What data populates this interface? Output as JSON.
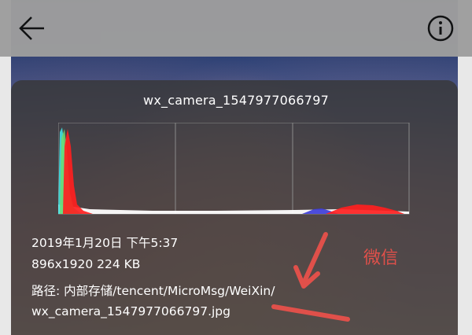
{
  "header": {
    "back_icon": "arrow-left-icon",
    "info_icon": "info-circle-icon"
  },
  "details": {
    "filename": "wx_camera_1547977066797",
    "date_time": "2019年1月20日 下午5:37",
    "dimensions_size": "896x1920  224 KB",
    "path_line1": "路径: 内部存储/tencent/MicroMsg/WeiXin/",
    "path_line2": "wx_camera_1547977066797.jpg"
  },
  "annotation": {
    "label": "微信",
    "color": "#e0504a"
  },
  "colors": {
    "panel": "#373737",
    "top_bar": "#9e9e9e",
    "histogram_red": "#ff2020",
    "histogram_cyan": "#40e0e0"
  }
}
